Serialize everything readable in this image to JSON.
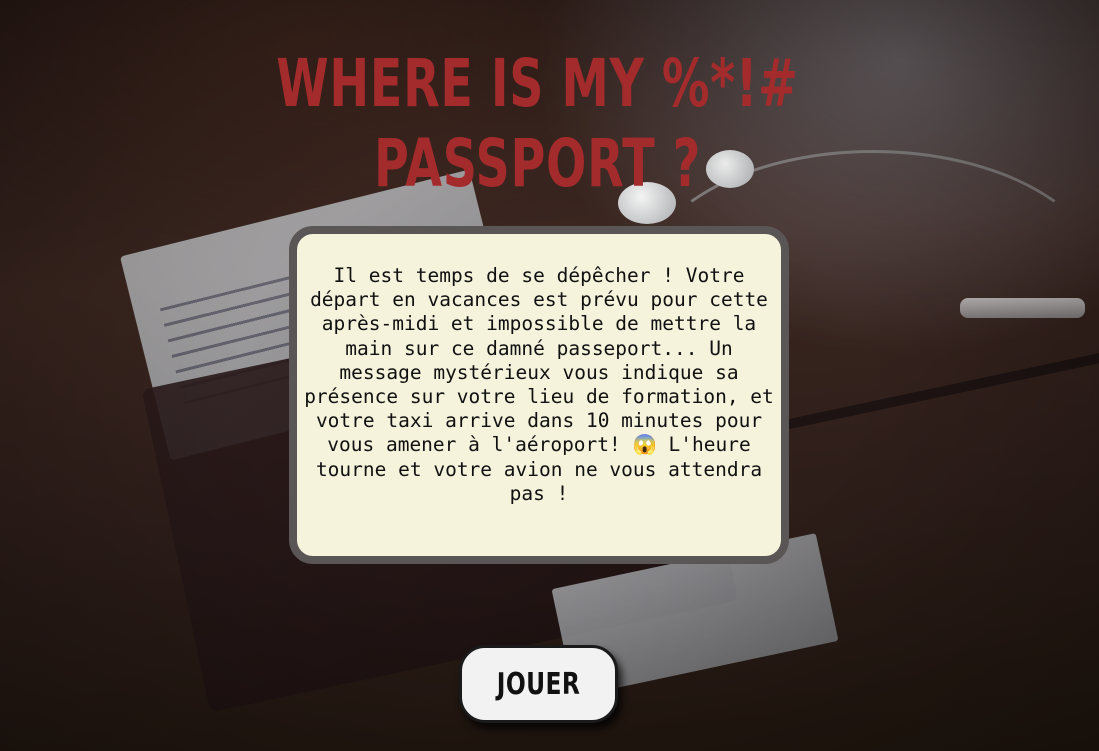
{
  "header": {
    "title": "WHERE IS MY %*!# PASSPORT ?"
  },
  "story": {
    "text": "Il est temps de se dépêcher ! Votre départ en vacances est prévu pour cette après-midi et impossible de mettre la main sur ce damné passeport... Un message mystérieux vous indique sa présence sur votre lieu de formation, et votre taxi arrive dans 10 minutes pour vous amener à l'aéroport! 😱 L'heure tourne et votre avion ne vous attendra pas !"
  },
  "actions": {
    "play_label": "JOUER"
  },
  "theme": {
    "title_color": "#a42b2b",
    "box_background": "#f5f3dc",
    "box_border": "#5b5656"
  },
  "background": {
    "scene": "passport-and-earphones-photo"
  }
}
